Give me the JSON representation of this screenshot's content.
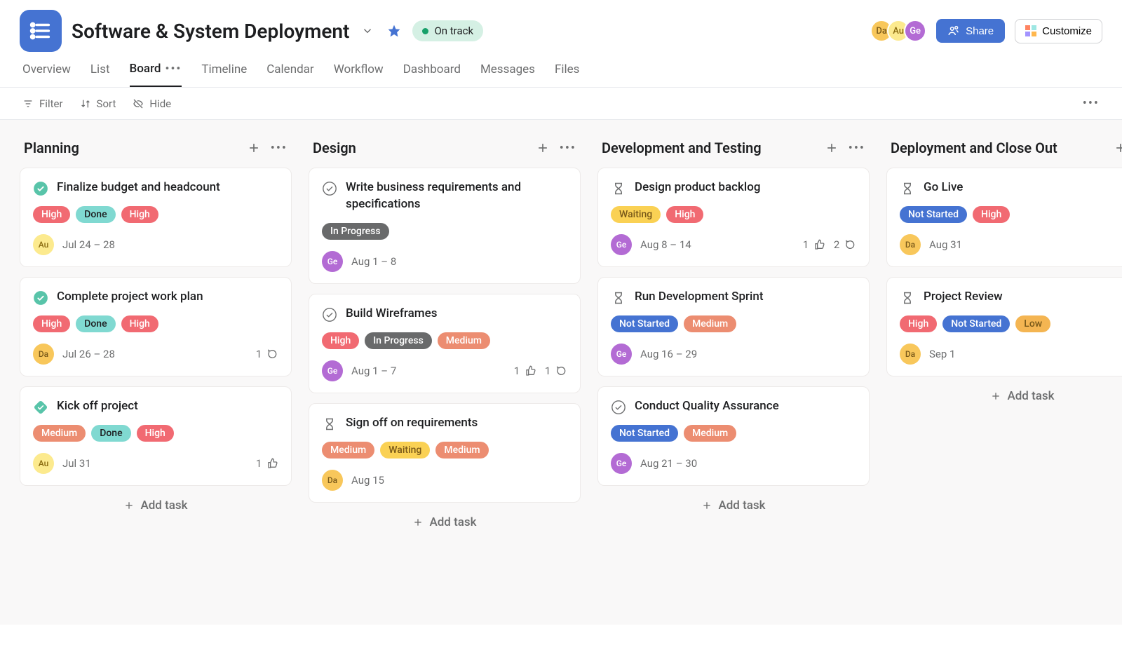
{
  "header": {
    "project_title": "Software & System Deployment",
    "status_label": "On track",
    "share_label": "Share",
    "customize_label": "Customize",
    "avatars": [
      "Da",
      "Au",
      "Ge"
    ]
  },
  "tabs": {
    "items": [
      "Overview",
      "List",
      "Board",
      "Timeline",
      "Calendar",
      "Workflow",
      "Dashboard",
      "Messages",
      "Files"
    ],
    "active": "Board"
  },
  "toolbar": {
    "filter": "Filter",
    "sort": "Sort",
    "hide": "Hide"
  },
  "add_task_label": "Add task",
  "columns": [
    {
      "title": "Planning",
      "cards": [
        {
          "icon": "done",
          "title": "Finalize budget and headcount",
          "tags": [
            {
              "t": "High",
              "c": "high"
            },
            {
              "t": "Done",
              "c": "done"
            },
            {
              "t": "High",
              "c": "high"
            }
          ],
          "assignee": "Au",
          "date": "Jul 24 – 28"
        },
        {
          "icon": "done",
          "title": "Complete project work plan",
          "tags": [
            {
              "t": "High",
              "c": "high"
            },
            {
              "t": "Done",
              "c": "done"
            },
            {
              "t": "High",
              "c": "high"
            }
          ],
          "assignee": "Da",
          "date": "Jul 26 – 28",
          "comments": 1
        },
        {
          "icon": "done-diamond",
          "title": "Kick off project",
          "tags": [
            {
              "t": "Medium",
              "c": "medium"
            },
            {
              "t": "Done",
              "c": "done"
            },
            {
              "t": "High",
              "c": "high"
            }
          ],
          "assignee": "Au",
          "date": "Jul 31",
          "likes": 1
        }
      ]
    },
    {
      "title": "Design",
      "cards": [
        {
          "icon": "todo",
          "title": "Write business requirements and specifications",
          "tags": [
            {
              "t": "In Progress",
              "c": "inprogress"
            }
          ],
          "assignee": "Ge",
          "date": "Aug 1 – 8"
        },
        {
          "icon": "todo",
          "title": "Build Wireframes",
          "tags": [
            {
              "t": "High",
              "c": "high"
            },
            {
              "t": "In Progress",
              "c": "inprogress"
            },
            {
              "t": "Medium",
              "c": "medium"
            }
          ],
          "assignee": "Ge",
          "date": "Aug 1 – 7",
          "likes": 1,
          "comments": 1
        },
        {
          "icon": "hourglass",
          "title": "Sign off on requirements",
          "tags": [
            {
              "t": "Medium",
              "c": "medium"
            },
            {
              "t": "Waiting",
              "c": "waiting"
            },
            {
              "t": "Medium",
              "c": "medium"
            }
          ],
          "assignee": "Da",
          "date": "Aug 15"
        }
      ]
    },
    {
      "title": "Development and Testing",
      "cards": [
        {
          "icon": "hourglass",
          "title": "Design product backlog",
          "tags": [
            {
              "t": "Waiting",
              "c": "waiting"
            },
            {
              "t": "High",
              "c": "high"
            }
          ],
          "assignee": "Ge",
          "date": "Aug 8 – 14",
          "likes": 1,
          "comments": 2
        },
        {
          "icon": "hourglass",
          "title": "Run Development Sprint",
          "tags": [
            {
              "t": "Not Started",
              "c": "notstarted"
            },
            {
              "t": "Medium",
              "c": "medium"
            }
          ],
          "assignee": "Ge",
          "date": "Aug 16 – 29"
        },
        {
          "icon": "todo",
          "title": "Conduct Quality Assurance",
          "tags": [
            {
              "t": "Not Started",
              "c": "notstarted"
            },
            {
              "t": "Medium",
              "c": "medium"
            }
          ],
          "assignee": "Ge",
          "date": "Aug 21 – 30"
        }
      ]
    },
    {
      "title": "Deployment and Close Out",
      "cards": [
        {
          "icon": "hourglass",
          "title": "Go Live",
          "tags": [
            {
              "t": "Not Started",
              "c": "notstarted"
            },
            {
              "t": "High",
              "c": "high"
            }
          ],
          "assignee": "Da",
          "date": "Aug 31"
        },
        {
          "icon": "hourglass",
          "title": "Project Review",
          "tags": [
            {
              "t": "High",
              "c": "high"
            },
            {
              "t": "Not Started",
              "c": "notstarted"
            },
            {
              "t": "Low",
              "c": "low"
            }
          ],
          "assignee": "Da",
          "date": "Sep 1"
        }
      ]
    }
  ]
}
